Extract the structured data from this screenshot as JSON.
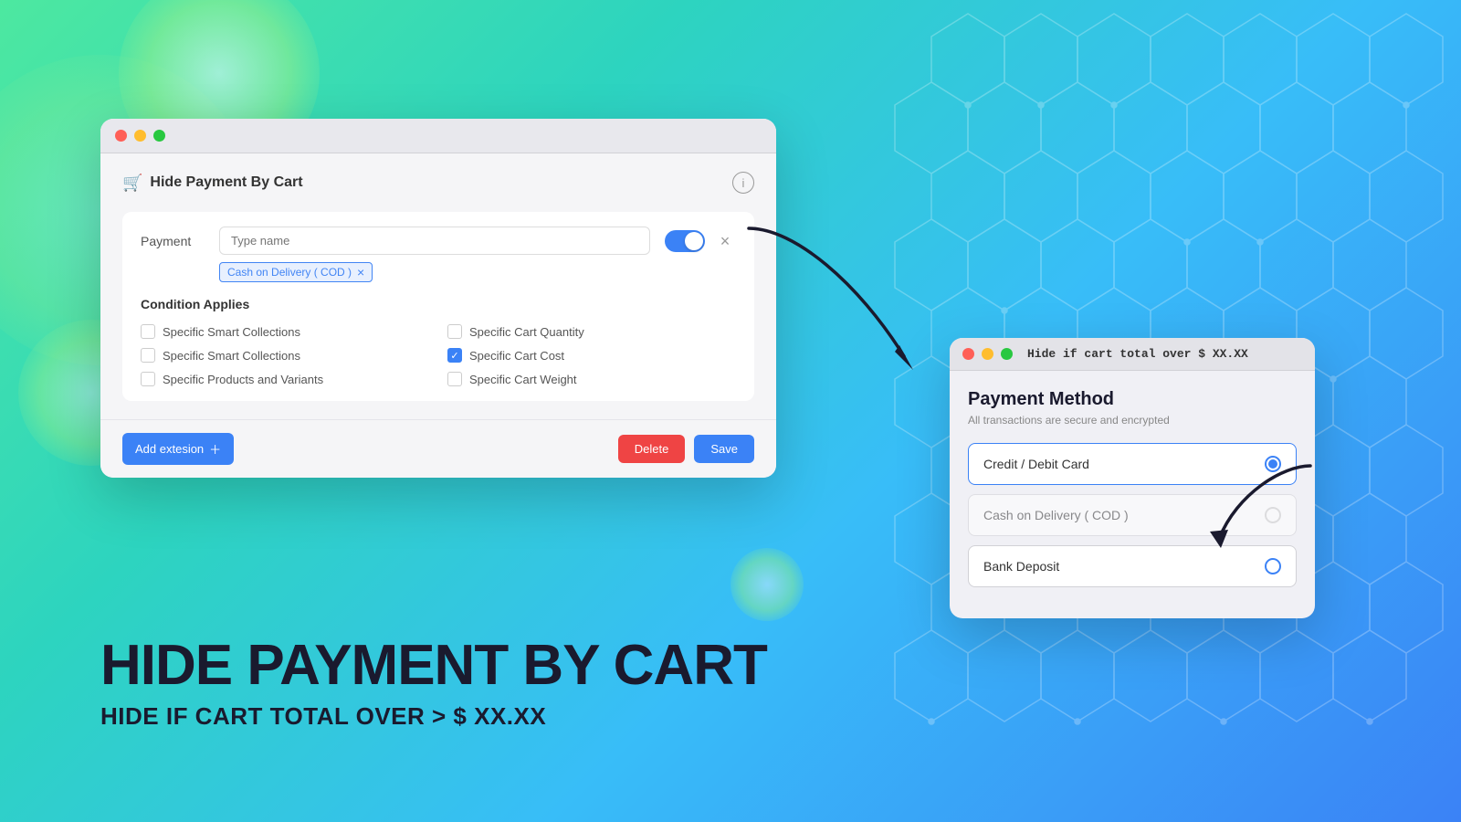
{
  "background": {
    "gradient_start": "#4de8a0",
    "gradient_end": "#3b82f6"
  },
  "main_window": {
    "title": "Hide Payment By Cart",
    "traffic_lights": [
      "red",
      "yellow",
      "green"
    ],
    "info_icon": "ℹ",
    "payment_section": {
      "label": "Payment",
      "input_placeholder": "Type name",
      "tag": "Cash on Delivery ( COD )",
      "tag_removable": true
    },
    "toggle_on": true,
    "condition_section": {
      "title": "Condition Applies",
      "conditions": [
        {
          "id": "ssc1",
          "label": "Specific Smart Collections",
          "checked": false,
          "col": "left"
        },
        {
          "id": "ssc2",
          "label": "Specific Smart Collections",
          "checked": false,
          "col": "left"
        },
        {
          "id": "spv",
          "label": "Specific Products and Variants",
          "checked": false,
          "col": "left"
        },
        {
          "id": "scq",
          "label": "Specific Cart Quantity",
          "checked": false,
          "col": "right"
        },
        {
          "id": "scc",
          "label": "Specific Cart Cost",
          "checked": true,
          "col": "right"
        },
        {
          "id": "scw",
          "label": "Specific Cart Weight",
          "checked": false,
          "col": "right"
        }
      ]
    },
    "footer": {
      "add_extension_label": "Add extesion",
      "delete_label": "Delete",
      "save_label": "Save"
    }
  },
  "payment_window": {
    "traffic_lights": [
      "red",
      "yellow",
      "green"
    ],
    "annotation": "Hide if cart total over $ XX.XX",
    "title": "Payment Method",
    "subtitle": "All transactions are secure and encrypted",
    "options": [
      {
        "id": "credit",
        "label": "Credit / Debit Card",
        "selected": true,
        "disabled": false
      },
      {
        "id": "cod",
        "label": "Cash on Delivery ( COD )",
        "selected": false,
        "disabled": true
      },
      {
        "id": "bank",
        "label": "Bank Deposit",
        "selected": false,
        "disabled": false
      }
    ]
  },
  "hero": {
    "title": "HIDE PAYMENT BY CART",
    "subtitle": "HIDE IF CART TOTAL OVER > $ XX.XX"
  }
}
